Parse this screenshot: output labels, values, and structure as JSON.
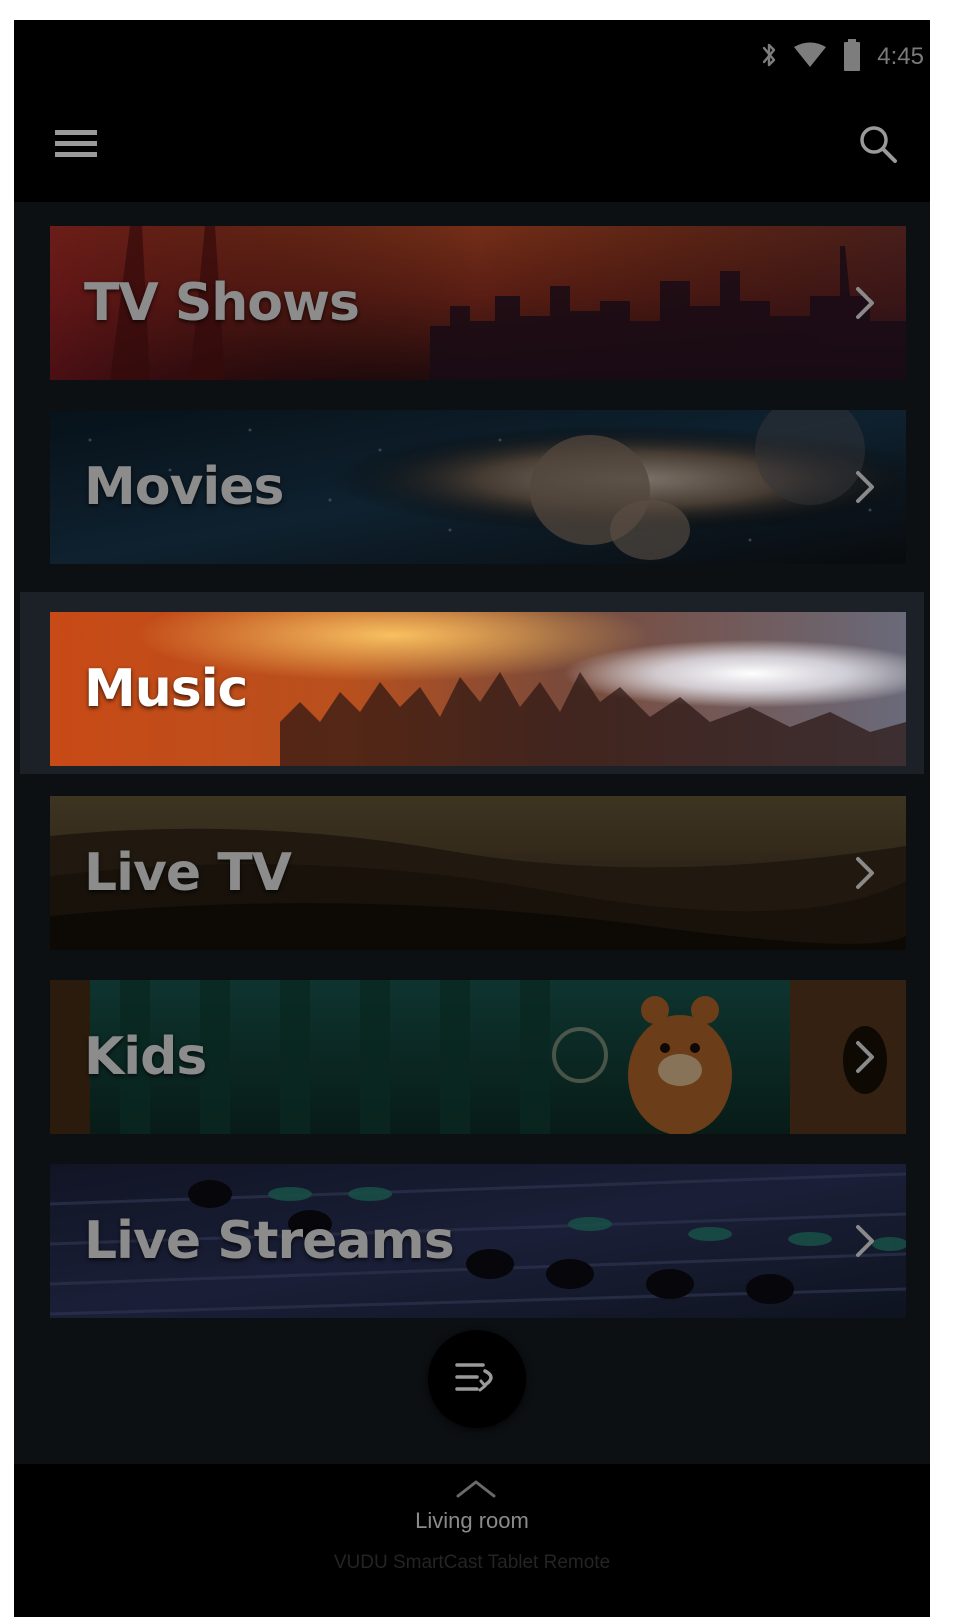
{
  "status_bar": {
    "time": "4:45",
    "icons": [
      "bluetooth-icon",
      "wifi-icon",
      "battery-icon"
    ]
  },
  "app_bar": {
    "menu_icon": "menu-icon",
    "search_icon": "search-icon"
  },
  "categories": [
    {
      "label": "TV Shows",
      "state": "normal",
      "art": "city-skyline-sunset"
    },
    {
      "label": "Movies",
      "state": "normal",
      "art": "astronaut-space"
    },
    {
      "label": "Music",
      "state": "selected",
      "art": "concert-crowd"
    },
    {
      "label": "Live TV",
      "state": "normal",
      "art": "desert-landscape"
    },
    {
      "label": "Kids",
      "state": "normal",
      "art": "cartoon-bear-forest"
    },
    {
      "label": "Live Streams",
      "state": "normal",
      "art": "mixing-console"
    }
  ],
  "fab": {
    "icon": "switch-remote-icon"
  },
  "bottom_bar": {
    "device_name": "Living room",
    "subtitle": "VUDU SmartCast Tablet Remote",
    "chevron_icon": "chevron-up-icon"
  },
  "colors": {
    "background": "#000000",
    "content_background": "#0d1013",
    "selected_band": "#1c2127",
    "label_dim": "#8c8c8c",
    "label_active": "#ffffff"
  }
}
